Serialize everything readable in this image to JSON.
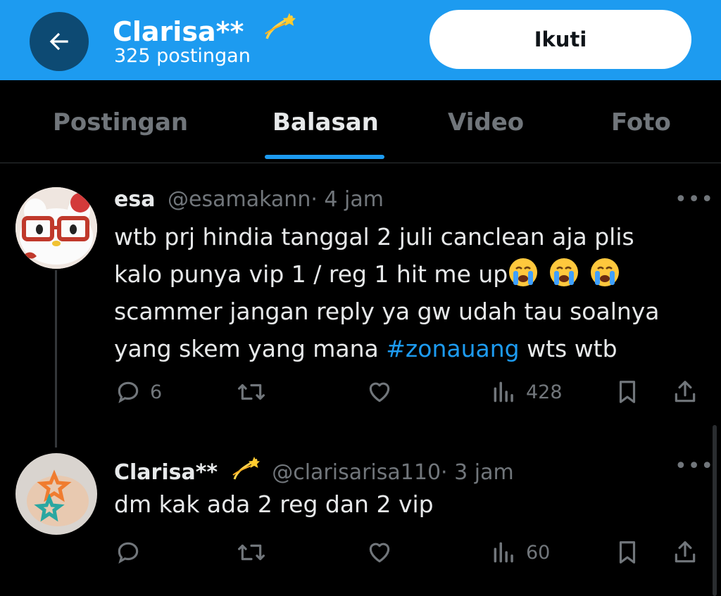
{
  "header": {
    "name": "Clarisa**",
    "name_emoji": "dizzy-emoji",
    "post_count": "325 postingan",
    "follow_label": "Ikuti",
    "accent_color": "#1d9bf0"
  },
  "tabs": [
    {
      "label": "Postingan",
      "active": false
    },
    {
      "label": "Balasan",
      "active": true
    },
    {
      "label": "Video",
      "active": false
    },
    {
      "label": "Foto",
      "active": false
    }
  ],
  "tweets": [
    {
      "name": "esa",
      "handle": "@esamakann",
      "time": "· 4 jam",
      "text_line1": "wtb prj hindia tanggal 2 juli canclean aja plis",
      "text_line2": "kalo punya vip 1 / reg 1 hit me up",
      "text_line2_emoji": "loudly-crying-face-emoji x3",
      "text_line3": "scammer jangan reply ya gw udah tau soalnya",
      "text_line4_pre": "yang skem yang mana ",
      "hashtag": "#zonauang",
      "text_line4_post": " wts wtb",
      "replies": "6",
      "reposts": "",
      "likes": "",
      "views": "428"
    },
    {
      "name": "Clarisa**",
      "name_emoji": "dizzy-emoji",
      "handle": "@clarisarisa110",
      "time": "· 3 jam",
      "text": "dm kak ada 2 reg dan 2 vip",
      "replies": "",
      "reposts": "",
      "likes": "",
      "views": "60"
    }
  ],
  "more_glyph": "•••"
}
